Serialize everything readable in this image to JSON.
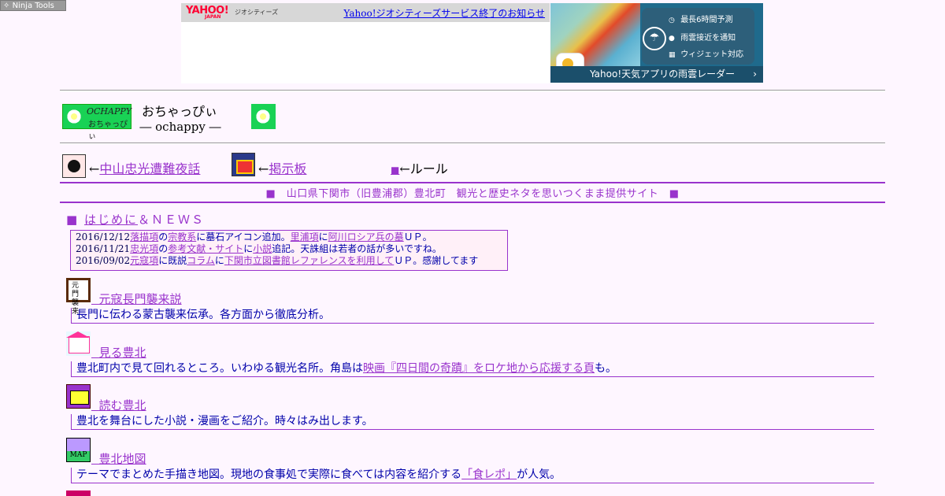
{
  "ninja": {
    "label": "Ninja Tools"
  },
  "geo_banner": {
    "logo": "YAHOO!",
    "logo_sub": "JAPAN",
    "service": "ジオシティーズ",
    "notice": "Yahoo!ジオシティーズサービス終了のお知らせ"
  },
  "weather_ad": {
    "features": [
      "最長6時間予測",
      "雨雲接近を通知",
      "ウィジェット対応"
    ],
    "cta": "Yahoo!天気アプリの雨雲レーダー"
  },
  "header": {
    "logo_text_1": "OCHAPPY",
    "logo_text_2": "おちゃっぴぃ",
    "title": "おちゃっぴぃ",
    "subtitle": "― ochappy ―"
  },
  "nav": {
    "item1_prefix": "←",
    "item1_link": "中山忠光遭難夜話",
    "item2_prefix": "←",
    "item2_link": "掲示板",
    "rule_marker": "■",
    "rule_label": "←ルール"
  },
  "tagline": "■　山口県下関市（旧豊浦郡）豊北町　観光と歴史ネタを思いつくまま提供サイト　■",
  "news": {
    "heading_marker": "■",
    "heading_link": "はじめに",
    "heading_rest": "＆ＮＥＷＳ",
    "entries": [
      {
        "date": "2016/12/12",
        "parts": [
          "落描項",
          "の",
          "宗教系",
          "に墓石アイコン追加。",
          "里浦項",
          "に",
          "阿川ロシア兵の墓",
          "ＵＰ。"
        ]
      },
      {
        "date": "2016/11/21",
        "parts": [
          "忠光項",
          "の",
          "参考文献・サイト",
          "に",
          "小説",
          "追記。天誅組は若者の話が多いですね。",
          "",
          ""
        ]
      },
      {
        "date": "2016/09/02",
        "parts": [
          "元寇項",
          "に既説",
          "コラム",
          "に",
          "下関市立図書館レファレンスを利用して",
          "ＵＰ。感謝してます",
          "",
          ""
        ]
      }
    ]
  },
  "sections": [
    {
      "link": "元寇長門襲来説",
      "desc": "長門に伝わる蒙古襲来伝承。各方面から徹底分析。",
      "desc_link": "",
      "desc_after": ""
    },
    {
      "link": "見る豊北",
      "desc": "豊北町内で見て回れるところ。いわゆる観光名所。角島は",
      "desc_link": "映画『四日間の奇蹟』をロケ地から応援する頁",
      "desc_after": "も。"
    },
    {
      "link": "読む豊北",
      "desc": "豊北を舞台にした小説・漫画をご紹介。時々はみ出します。",
      "desc_link": "",
      "desc_after": ""
    },
    {
      "link": "豊北地図",
      "desc": "テーマでまとめた手描き地図。現地の食事処で実際に食べては内容を紹介する",
      "desc_link": "「食レポ」",
      "desc_after": "が人気。"
    }
  ],
  "section_icon_labels": [
    "元門襲来",
    "MAP"
  ]
}
